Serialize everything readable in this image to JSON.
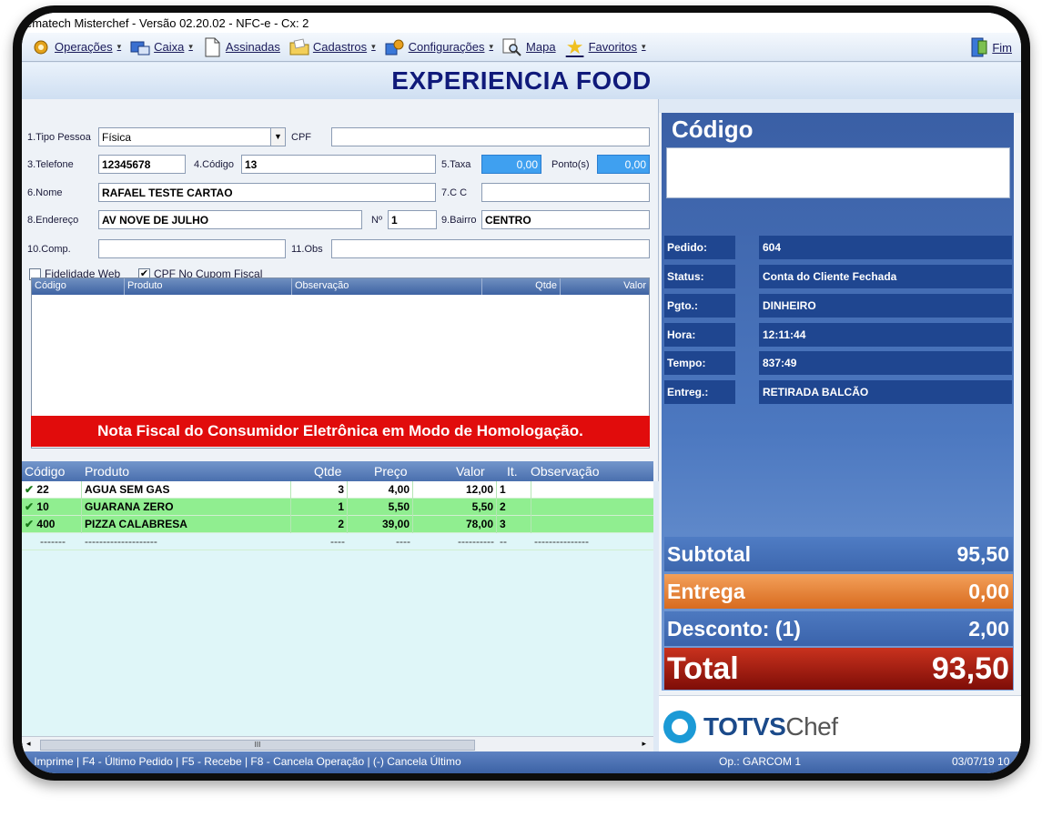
{
  "window": {
    "title": "ematech Misterchef - Versão 02.20.02 - NFC-e - Cx: 2"
  },
  "menu": {
    "items": [
      {
        "label": "Operações",
        "icon": "gears-icon",
        "caret": "▾"
      },
      {
        "label": "Caixa",
        "icon": "cashier-icon",
        "caret": "▾"
      },
      {
        "label": "Assinadas",
        "icon": "document-icon",
        "caret": ""
      },
      {
        "label": "Cadastros",
        "icon": "folder-icon",
        "caret": "▾"
      },
      {
        "label": "Configurações",
        "icon": "settings-icon",
        "caret": "▾"
      },
      {
        "label": "Mapa",
        "icon": "magnifier-icon",
        "caret": ""
      },
      {
        "label": "Favoritos",
        "icon": "star-icon",
        "caret": "▾"
      }
    ],
    "exit_label": "Fim"
  },
  "store_name": "EXPERIENCIA FOOD",
  "form": {
    "tipo_pessoa_label": "1.Tipo Pessoa",
    "tipo_pessoa_value": "Física",
    "cpf_label": "CPF",
    "cpf_value": "",
    "telefone_label": "3.Telefone",
    "telefone_value": "12345678",
    "codigo_label": "4.Código",
    "codigo_value": "13",
    "taxa_label": "5.Taxa",
    "taxa_value": "0,00",
    "pontos_label": "Ponto(s)",
    "pontos_value": "0,00",
    "nome_label": "6.Nome",
    "nome_value": "RAFAEL TESTE CARTAO",
    "cc_label": "7.C C",
    "cc_value": "",
    "endereco_label": "8.Endereço",
    "endereco_value": "AV NOVE DE JULHO",
    "numero_label": "Nº",
    "numero_value": "1",
    "bairro_label": "9.Bairro",
    "bairro_value": "CENTRO",
    "comp_label": "10.Comp.",
    "comp_value": "",
    "obs_label": "11.Obs",
    "obs_value": "",
    "fidelidade_label": "Fidelidade Web",
    "fidelidade_checked": false,
    "cpf_cupom_label": "CPF No Cupom Fiscal",
    "cpf_cupom_checked": true
  },
  "grid_top": {
    "columns": [
      "Código",
      "Produto",
      "Observação",
      "Qtde",
      "Valor"
    ],
    "notice": "Nota Fiscal do Consumidor Eletrônica em Modo de Homologação."
  },
  "items": {
    "columns": [
      "Código",
      "Produto",
      "Qtde",
      "Preço",
      "Valor",
      "It.",
      "Observação"
    ],
    "rows": [
      {
        "codigo": "22",
        "produto": "AGUA SEM GAS",
        "qtde": "3",
        "preco": "4,00",
        "valor": "12,00",
        "it": "1",
        "obs": ""
      },
      {
        "codigo": "10",
        "produto": "GUARANA ZERO",
        "qtde": "1",
        "preco": "5,50",
        "valor": "5,50",
        "it": "2",
        "obs": ""
      },
      {
        "codigo": "400",
        "produto": "PIZZA CALABRESA",
        "qtde": "2",
        "preco": "39,00",
        "valor": "78,00",
        "it": "3",
        "obs": ""
      }
    ],
    "dash_row": {
      "codigo": "-------",
      "produto": "--------------------",
      "qtde": "----",
      "preco": "----",
      "valor": "----------",
      "it": "--",
      "obs": "---------------"
    },
    "scroll_glyph": "III"
  },
  "side": {
    "codigo_title": "Código",
    "codigo_value": "",
    "info": [
      {
        "label": "Pedido:",
        "value": "604"
      },
      {
        "label": "Status:",
        "value": "Conta do Cliente Fechada"
      },
      {
        "label": "Pgto.:",
        "value": "DINHEIRO"
      },
      {
        "label": "Hora:",
        "value": "12:11:44"
      },
      {
        "label": "Tempo:",
        "value": "837:49"
      },
      {
        "label": "Entreg.:",
        "value": "RETIRADA BALCÃO"
      }
    ],
    "subtotal_label": "Subtotal",
    "subtotal_value": "95,50",
    "entrega_label": "Entrega",
    "entrega_value": "0,00",
    "desconto_label": "Desconto: (1)",
    "desconto_value": "2,00",
    "total_label": "Total",
    "total_value": "93,50",
    "brand_main": "TOTVS",
    "brand_sub": "Chef"
  },
  "statusbar": {
    "shortcuts": "- Imprime  |  F4 - Último Pedido  |  F5 - Recebe  |  F8 - Cancela Operação  |  (-) Cancela Último",
    "operator": "Op.: GARCOM 1",
    "date": "03/07/19 10"
  },
  "colors": {
    "accent_blue": "#1f4690",
    "notice_red": "#e10c0c",
    "row_highlight": "#90ee90",
    "total_red": "#9e1a0f",
    "entrega_orange": "#e07a2c"
  }
}
